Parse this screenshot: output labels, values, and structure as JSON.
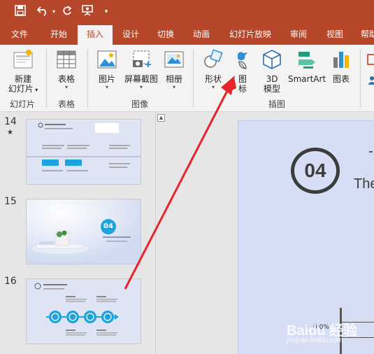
{
  "qat": {
    "save_icon": "save-icon",
    "undo_icon": "undo-icon",
    "redo_icon": "redo-icon",
    "present_icon": "presentation-icon",
    "customize_icon": "customize-qat-icon"
  },
  "tabs": [
    "文件",
    "开始",
    "插入",
    "设计",
    "切换",
    "动画",
    "幻灯片放映",
    "审阅",
    "视图",
    "帮助"
  ],
  "active_tab": "插入",
  "ribbon": {
    "new_slide": {
      "line1": "新建",
      "line2": "幻灯片"
    },
    "table": "表格",
    "picture": "图片",
    "screenshot": "屏幕截图",
    "album": "相册",
    "shapes": "形状",
    "icons": {
      "line1": "图",
      "line2": "标"
    },
    "model3d": {
      "line1": "3D",
      "line2": "模型"
    },
    "smartart": "SmartArt",
    "chart": "图表",
    "groups": {
      "slides": "幻灯片",
      "tables": "表格",
      "images": "图像",
      "illustrations": "插图"
    }
  },
  "slides": [
    {
      "number": "14",
      "marker": "★"
    },
    {
      "number": "15",
      "badge": "04"
    },
    {
      "number": "16"
    }
  ],
  "editor": {
    "big_number": "04",
    "partial_text": "The",
    "percent": "0.0%"
  },
  "watermark": {
    "main": "Baidu 经验",
    "sub": "jingyan.baidu.com"
  },
  "colors": {
    "brand": "#b7472a",
    "ribbon": "#f3f3f3",
    "slide_bg": "#d6def5",
    "accent_blue": "#1fa3dc",
    "arrow": "#e8242b"
  }
}
